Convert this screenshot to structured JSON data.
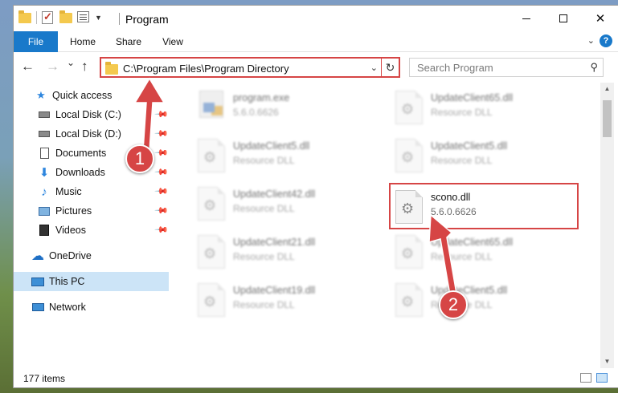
{
  "window": {
    "title": "Program",
    "controls": {
      "minimize_icon": "minimize-icon",
      "maximize_icon": "maximize-icon",
      "close_label": "✕"
    }
  },
  "quick_access_toolbar": [
    "folder-icon",
    "properties-checkmark-icon",
    "new-folder-icon",
    "properties-icon",
    "customize-dropdown-icon"
  ],
  "ribbon": {
    "tabs": [
      {
        "label": "File",
        "active": true
      },
      {
        "label": "Home"
      },
      {
        "label": "Share"
      },
      {
        "label": "View"
      }
    ]
  },
  "navigation": {
    "back": "←",
    "forward": "→",
    "recent": "⌄",
    "up": "↑",
    "address_path": "C:\\Program Files\\Program Directory",
    "search_placeholder": "Search Program"
  },
  "sidebar": {
    "items": [
      {
        "label": "Quick access",
        "icon": "star-icon"
      },
      {
        "label": "Local Disk (C:)",
        "icon": "drive-icon",
        "pinned": true
      },
      {
        "label": "Local Disk (D:)",
        "icon": "drive-icon",
        "pinned": true
      },
      {
        "label": "Documents",
        "icon": "documents-icon",
        "pinned": true
      },
      {
        "label": "Downloads",
        "icon": "downloads-icon",
        "pinned": true
      },
      {
        "label": "Music",
        "icon": "music-icon",
        "pinned": true
      },
      {
        "label": "Pictures",
        "icon": "pictures-icon",
        "pinned": true
      },
      {
        "label": "Videos",
        "icon": "videos-icon",
        "pinned": true
      },
      {
        "label": "OneDrive",
        "icon": "onedrive-icon"
      },
      {
        "label": "This PC",
        "icon": "computer-icon",
        "selected": true
      },
      {
        "label": "Network",
        "icon": "network-icon"
      }
    ]
  },
  "files": [
    {
      "name": "program.exe",
      "desc": "5.6.0.6626",
      "type": "exe",
      "blurred": true
    },
    {
      "name": "UpdateClient65.dll",
      "desc": "Resource DLL",
      "blurred": true
    },
    {
      "name": "UpdateClient5.dll",
      "desc": "Resource DLL",
      "blurred": true
    },
    {
      "name": "UpdateClient5.dll",
      "desc": "Resource DLL",
      "blurred": true
    },
    {
      "name": "UpdateClient42.dll",
      "desc": "Resource DLL",
      "blurred": true
    },
    {
      "name": "scono.dll",
      "desc": "5.6.0.6626",
      "blurred": false,
      "highlighted": true
    },
    {
      "name": "UpdateClient21.dll",
      "desc": "Resource DLL",
      "blurred": true
    },
    {
      "name": "UpdateClient65.dll",
      "desc": "Resource DLL",
      "blurred": true
    },
    {
      "name": "UpdateClient19.dll",
      "desc": "Resource DLL",
      "blurred": true
    },
    {
      "name": "UpdateClient5.dll",
      "desc": "Resource DLL",
      "blurred": true
    }
  ],
  "status": {
    "item_count": "177 items"
  },
  "annotations": {
    "step1": "1",
    "step2": "2",
    "color": "#d64545"
  }
}
